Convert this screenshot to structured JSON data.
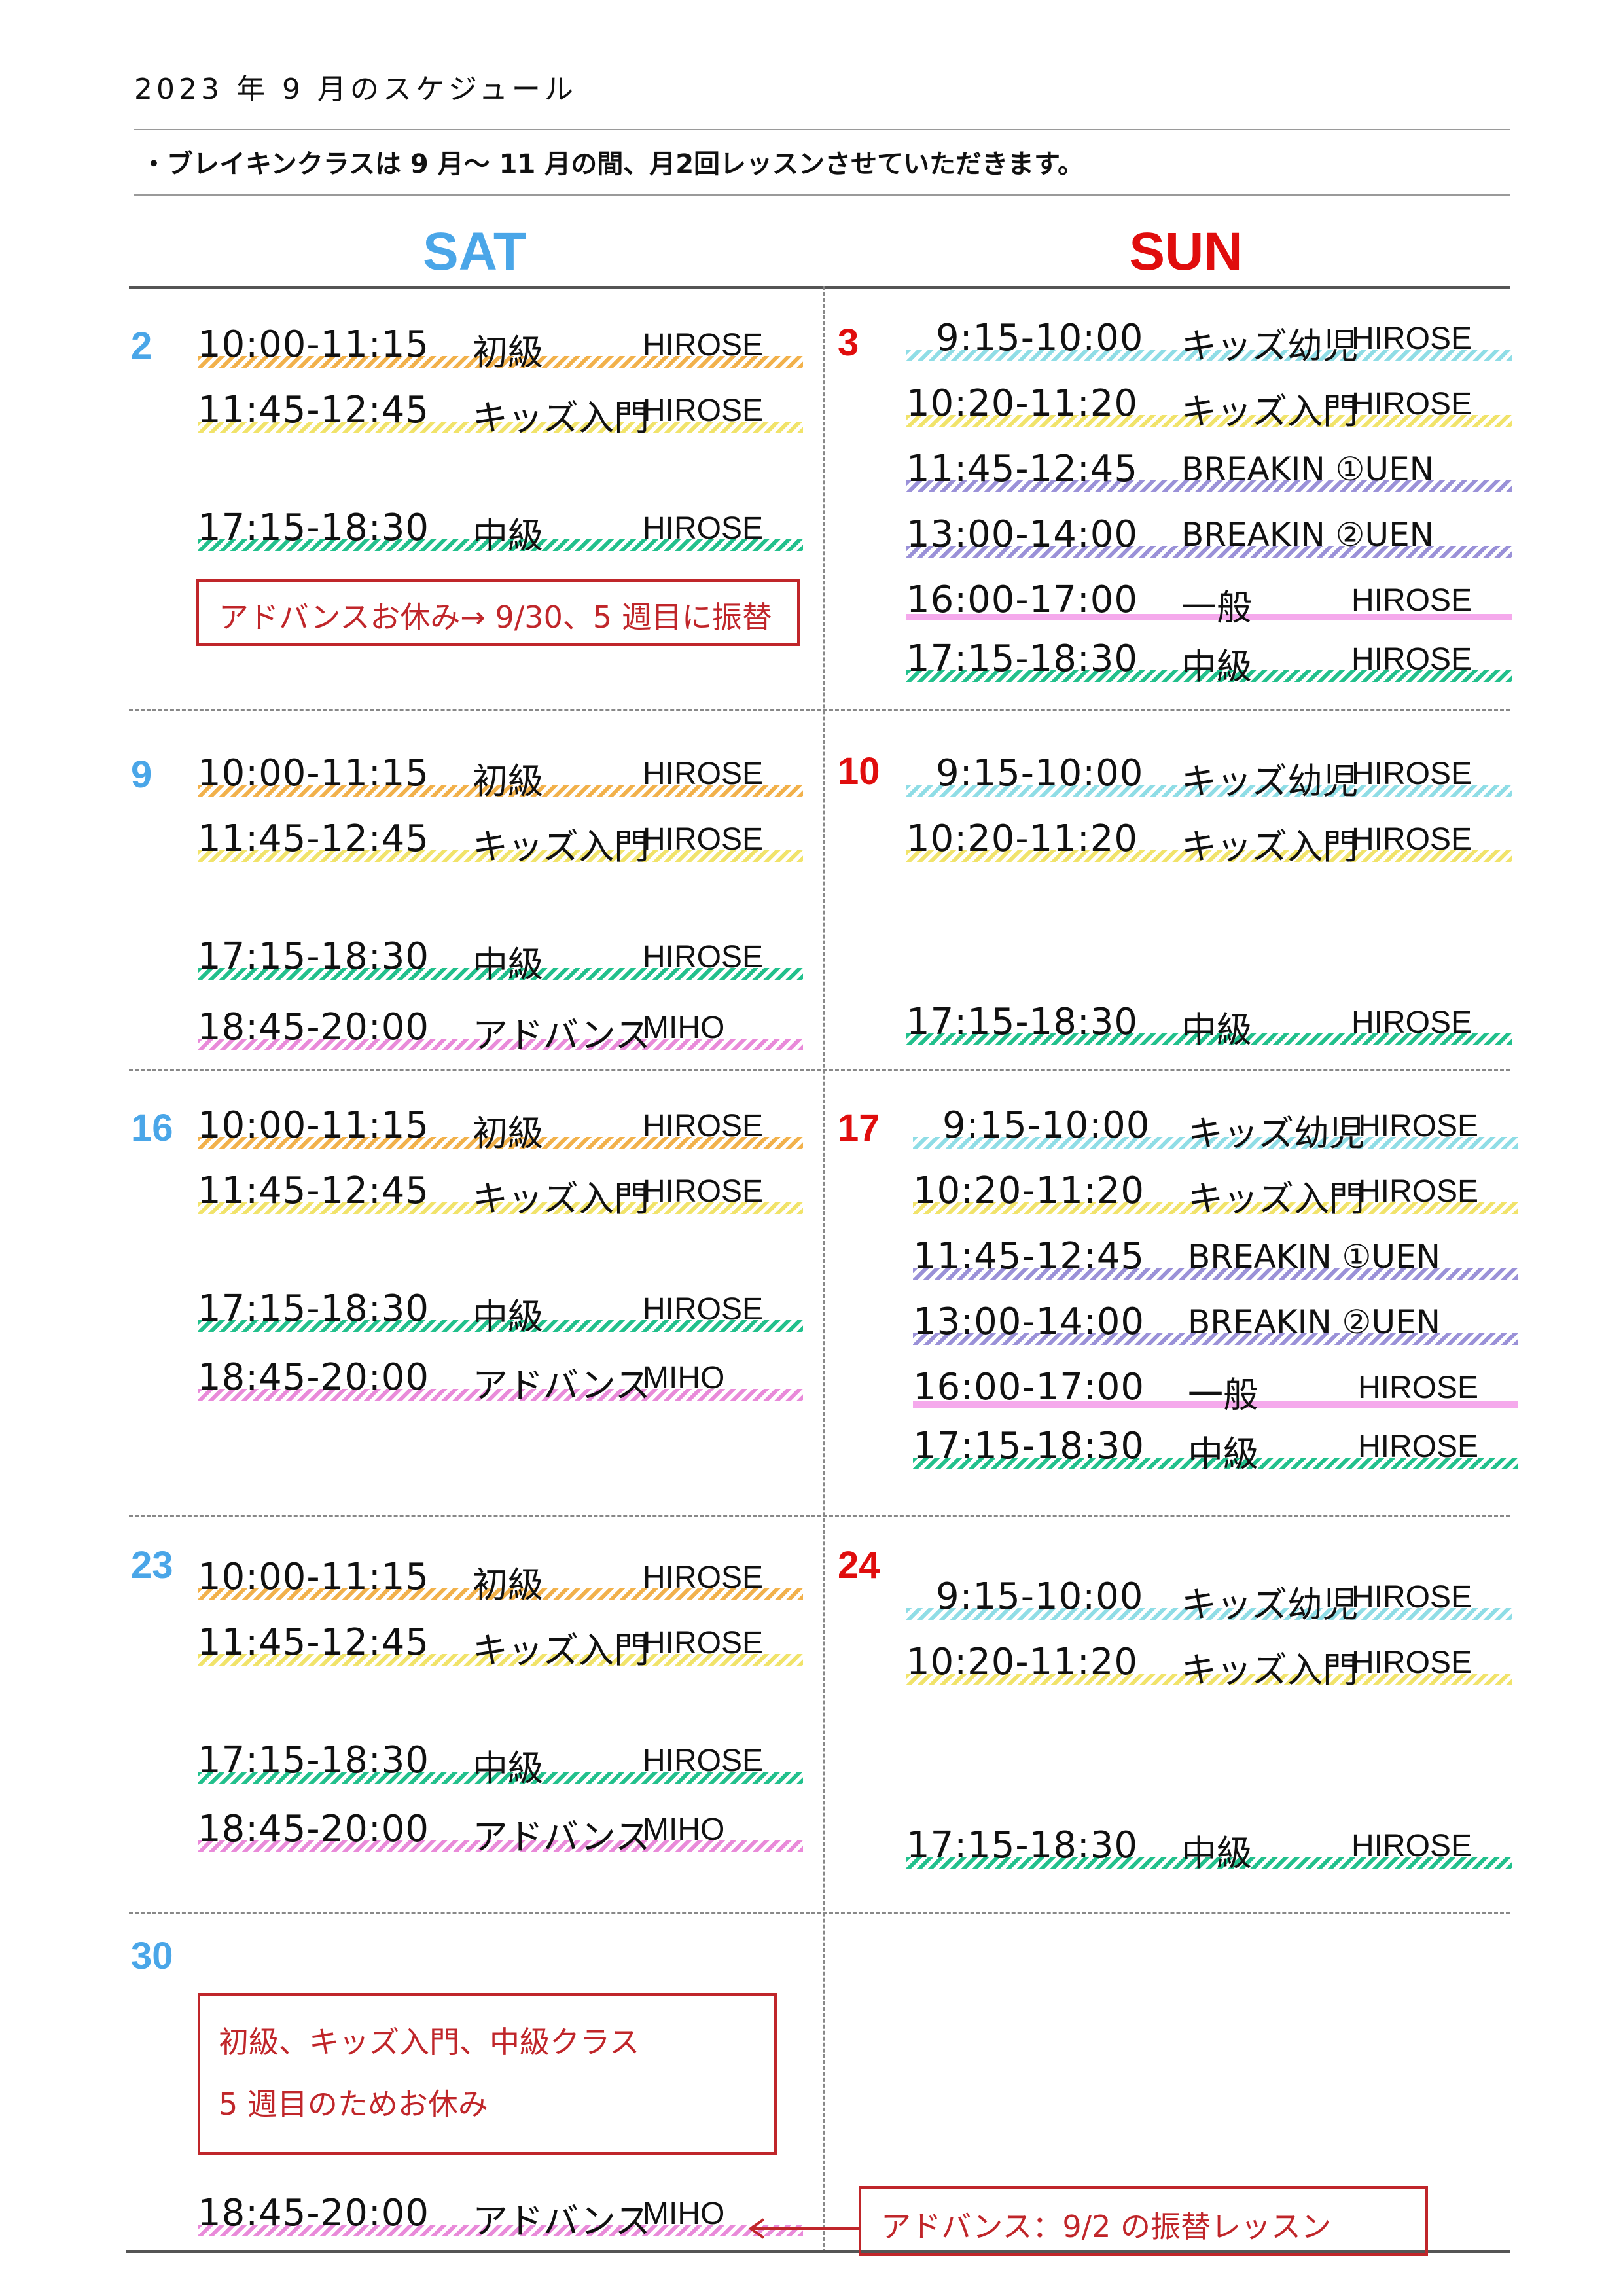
{
  "page": {
    "title": "2023 年 9 月のスケジュール",
    "note": "・ブレイキンクラスは 9 月〜 11 月の間、月2回レッスンさせていただきます。",
    "sat_label": "SAT",
    "sun_label": "SUN"
  },
  "colors": {
    "sat": "#4aa6e8",
    "sun": "#e00d0d",
    "notice": "#c0262a"
  },
  "weeks": [
    {
      "sat_day": "2",
      "sun_day": "3",
      "sat": [
        {
          "time": "10:00-11:15",
          "cls": "初級",
          "inst": "HIROSE",
          "stripe": "orange"
        },
        {
          "time": "11:45-12:45",
          "cls": "キッズ入門",
          "inst": "HIROSE",
          "stripe": "yellow"
        },
        {
          "time": "17:15-18:30",
          "cls": "中級",
          "inst": "HIROSE",
          "stripe": "green"
        }
      ],
      "sat_notice": "アドバンスお休み→ 9/30、5 週目に振替",
      "sun": [
        {
          "time": "9:15-10:00",
          "cls": "キッズ幼児",
          "inst": "HIROSE",
          "stripe": "cyan"
        },
        {
          "time": "10:20-11:20",
          "cls": "キッズ入門",
          "inst": "HIROSE",
          "stripe": "yellow"
        },
        {
          "time": "11:45-12:45",
          "cls": "BREAKIN ①UEN",
          "inst": "",
          "stripe": "purple"
        },
        {
          "time": "13:00-14:00",
          "cls": "BREAKIN ②UEN",
          "inst": "",
          "stripe": "purple"
        },
        {
          "time": "16:00-17:00",
          "cls": "一般",
          "inst": "HIROSE",
          "stripe": "solidpink"
        },
        {
          "time": "17:15-18:30",
          "cls": "中級",
          "inst": "HIROSE",
          "stripe": "green"
        }
      ]
    },
    {
      "sat_day": "9",
      "sun_day": "10",
      "sat": [
        {
          "time": "10:00-11:15",
          "cls": "初級",
          "inst": "HIROSE",
          "stripe": "orange"
        },
        {
          "time": "11:45-12:45",
          "cls": "キッズ入門",
          "inst": "HIROSE",
          "stripe": "yellow"
        },
        {
          "time": "17:15-18:30",
          "cls": "中級",
          "inst": "HIROSE",
          "stripe": "green"
        },
        {
          "time": "18:45-20:00",
          "cls": "アドバンス",
          "inst": "MIHO",
          "stripe": "pink"
        }
      ],
      "sun": [
        {
          "time": "9:15-10:00",
          "cls": "キッズ幼児",
          "inst": "HIROSE",
          "stripe": "cyan"
        },
        {
          "time": "10:20-11:20",
          "cls": "キッズ入門",
          "inst": "HIROSE",
          "stripe": "yellow"
        },
        {
          "time": "17:15-18:30",
          "cls": "中級",
          "inst": "HIROSE",
          "stripe": "green"
        }
      ]
    },
    {
      "sat_day": "16",
      "sun_day": "17",
      "sat": [
        {
          "time": "10:00-11:15",
          "cls": "初級",
          "inst": "HIROSE",
          "stripe": "orange"
        },
        {
          "time": "11:45-12:45",
          "cls": "キッズ入門",
          "inst": "HIROSE",
          "stripe": "yellow"
        },
        {
          "time": "17:15-18:30",
          "cls": "中級",
          "inst": "HIROSE",
          "stripe": "green"
        },
        {
          "time": "18:45-20:00",
          "cls": "アドバンス",
          "inst": "MIHO",
          "stripe": "pink"
        }
      ],
      "sun": [
        {
          "time": "9:15-10:00",
          "cls": "キッズ幼児",
          "inst": "HIROSE",
          "stripe": "cyan"
        },
        {
          "time": "10:20-11:20",
          "cls": "キッズ入門",
          "inst": "HIROSE",
          "stripe": "yellow"
        },
        {
          "time": "11:45-12:45",
          "cls": "BREAKIN ①UEN",
          "inst": "",
          "stripe": "purple"
        },
        {
          "time": "13:00-14:00",
          "cls": "BREAKIN ②UEN",
          "inst": "",
          "stripe": "purple"
        },
        {
          "time": "16:00-17:00",
          "cls": "一般",
          "inst": "HIROSE",
          "stripe": "solidpink"
        },
        {
          "time": "17:15-18:30",
          "cls": "中級",
          "inst": "HIROSE",
          "stripe": "green"
        }
      ]
    },
    {
      "sat_day": "23",
      "sun_day": "24",
      "sat": [
        {
          "time": "10:00-11:15",
          "cls": "初級",
          "inst": "HIROSE",
          "stripe": "orange"
        },
        {
          "time": "11:45-12:45",
          "cls": "キッズ入門",
          "inst": "HIROSE",
          "stripe": "yellow"
        },
        {
          "time": "17:15-18:30",
          "cls": "中級",
          "inst": "HIROSE",
          "stripe": "green"
        },
        {
          "time": "18:45-20:00",
          "cls": "アドバンス",
          "inst": "MIHO",
          "stripe": "pink"
        }
      ],
      "sun": [
        {
          "time": "9:15-10:00",
          "cls": "キッズ幼児",
          "inst": "HIROSE",
          "stripe": "cyan"
        },
        {
          "time": "10:20-11:20",
          "cls": "キッズ入門",
          "inst": "HIROSE",
          "stripe": "yellow"
        },
        {
          "time": "17:15-18:30",
          "cls": "中級",
          "inst": "HIROSE",
          "stripe": "green"
        }
      ]
    },
    {
      "sat_day": "30",
      "sat_notice_lines": [
        "初級、キッズ入門、中級クラス",
        "5 週目のためお休み"
      ],
      "sat": [
        {
          "time": "18:45-20:00",
          "cls": "アドバンス",
          "inst": "MIHO",
          "stripe": "pink"
        }
      ],
      "sun_notice": "アドバンス：9/2 の振替レッスン"
    }
  ]
}
